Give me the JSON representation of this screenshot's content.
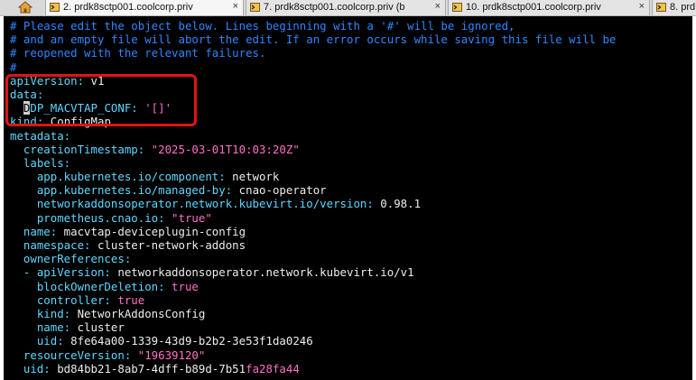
{
  "tabs": [
    {
      "label": "2. prdk8sctp001.coolcorp.priv",
      "active": true
    },
    {
      "label": "7. prdk8sctp001.coolcorp.priv (b",
      "active": false
    },
    {
      "label": "10. prdk8sctp001.coolcorp.priv",
      "active": false
    },
    {
      "label": "8. prd",
      "active": false
    }
  ],
  "close_glyph": "×",
  "terminal": {
    "lines": [
      [
        {
          "t": "# Please edit the object below. Lines beginning with a '#' will be ignored,",
          "c": "comment"
        }
      ],
      [
        {
          "t": "# and an empty file will abort the edit. If an error occurs while saving this file will be",
          "c": "comment"
        }
      ],
      [
        {
          "t": "# reopened with the relevant failures.",
          "c": "comment"
        }
      ],
      [
        {
          "t": "#",
          "c": "comment"
        }
      ],
      [
        {
          "t": "apiVersion:",
          "c": "key"
        },
        {
          "t": " v1",
          "c": "val"
        }
      ],
      [
        {
          "t": "data:",
          "c": "key"
        }
      ],
      [
        {
          "t": "  ",
          "c": "val"
        },
        {
          "t": "D",
          "c": "cursor"
        },
        {
          "t": "DP_MACVTAP_CONF:",
          "c": "key"
        },
        {
          "t": " '[]'",
          "c": "str"
        }
      ],
      [
        {
          "t": "kind:",
          "c": "key"
        },
        {
          "t": " ConfigMap",
          "c": "val"
        }
      ],
      [
        {
          "t": "metadata:",
          "c": "key"
        }
      ],
      [
        {
          "t": "  creationTimestamp:",
          "c": "key"
        },
        {
          "t": " \"2025-03-01T10:03:20Z\"",
          "c": "str"
        }
      ],
      [
        {
          "t": "  labels:",
          "c": "key"
        }
      ],
      [
        {
          "t": "    app.kubernetes.io/component:",
          "c": "key"
        },
        {
          "t": " network",
          "c": "val"
        }
      ],
      [
        {
          "t": "    app.kubernetes.io/managed-by:",
          "c": "key"
        },
        {
          "t": " cnao-operator",
          "c": "val"
        }
      ],
      [
        {
          "t": "    networkaddonsoperator.network.kubevirt.io/version:",
          "c": "key"
        },
        {
          "t": " 0.98.1",
          "c": "val"
        }
      ],
      [
        {
          "t": "    prometheus.cnao.io:",
          "c": "key"
        },
        {
          "t": " \"true\"",
          "c": "str"
        }
      ],
      [
        {
          "t": "  name:",
          "c": "key"
        },
        {
          "t": " macvtap-deviceplugin-config",
          "c": "val"
        }
      ],
      [
        {
          "t": "  namespace:",
          "c": "key"
        },
        {
          "t": " cluster-network-addons",
          "c": "val"
        }
      ],
      [
        {
          "t": "  ownerReferences:",
          "c": "key"
        }
      ],
      [
        {
          "t": "  - apiVersion:",
          "c": "key"
        },
        {
          "t": " networkaddonsoperator.network.kubevirt.io/v1",
          "c": "val"
        }
      ],
      [
        {
          "t": "    blockOwnerDeletion:",
          "c": "key"
        },
        {
          "t": " true",
          "c": "bool"
        }
      ],
      [
        {
          "t": "    controller:",
          "c": "key"
        },
        {
          "t": " true",
          "c": "bool"
        }
      ],
      [
        {
          "t": "    kind:",
          "c": "key"
        },
        {
          "t": " NetworkAddonsConfig",
          "c": "val"
        }
      ],
      [
        {
          "t": "    name:",
          "c": "key"
        },
        {
          "t": " cluster",
          "c": "val"
        }
      ],
      [
        {
          "t": "    uid:",
          "c": "key"
        },
        {
          "t": " 8fe64a00-1339-43d9-b2b2-3e53f1da0246",
          "c": "val"
        }
      ],
      [
        {
          "t": "  resourceVersion:",
          "c": "key"
        },
        {
          "t": " \"19639120\"",
          "c": "str"
        }
      ],
      [
        {
          "t": "  uid:",
          "c": "key"
        },
        {
          "t": " bd84bb21-8ab7-4dff-b89d-7b51",
          "c": "val"
        },
        {
          "t": "fa28fa44",
          "c": "str"
        }
      ],
      [
        {
          "t": "~",
          "c": "comment"
        }
      ]
    ]
  },
  "colors": {
    "comment": "#2f86ff",
    "key": "#5fd7ff",
    "string": "#ff6fc8",
    "highlight": "#e01414",
    "background": "#000000"
  },
  "icons": {
    "home": "home-icon",
    "tab": "terminal-tab-icon",
    "close": "close-icon"
  }
}
